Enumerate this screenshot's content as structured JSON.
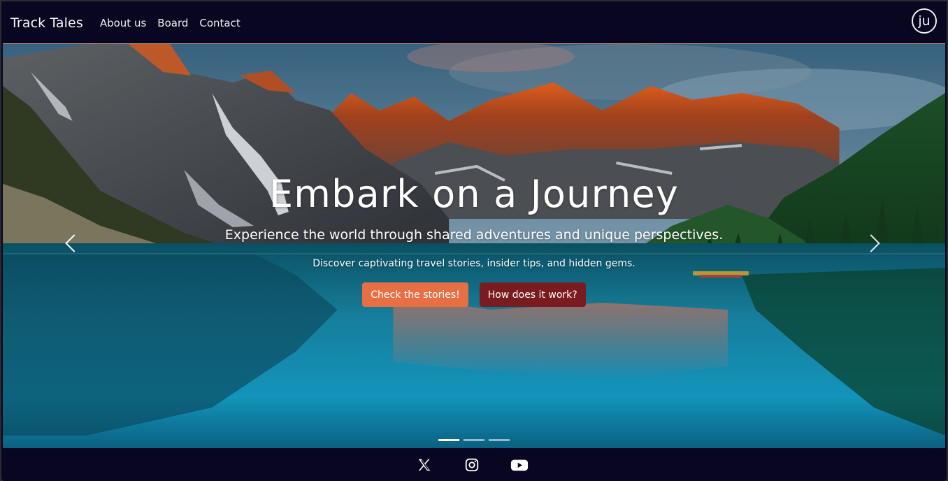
{
  "navbar": {
    "brand": "Track Tales",
    "links": [
      "About us",
      "Board",
      "Contact"
    ],
    "avatar_initials": "ju"
  },
  "hero": {
    "title": "Embark on a Journey",
    "subtitle": "Experience the world through shared adventures and unique perspectives.",
    "text": "Discover captivating travel stories, insider tips, and hidden gems.",
    "primary_button": "Check the stories!",
    "secondary_button": "How does it work?",
    "prev_icon": "chevron-left-icon",
    "next_icon": "chevron-right-icon",
    "slides_count": 3,
    "active_slide": 1
  },
  "footer": {
    "icons": [
      "x-icon",
      "instagram-icon",
      "youtube-icon"
    ]
  },
  "colors": {
    "navbar_bg": "#080620",
    "primary_button": "#e86f44",
    "secondary_button": "#7a1b1f",
    "text_light": "#ffffff"
  }
}
